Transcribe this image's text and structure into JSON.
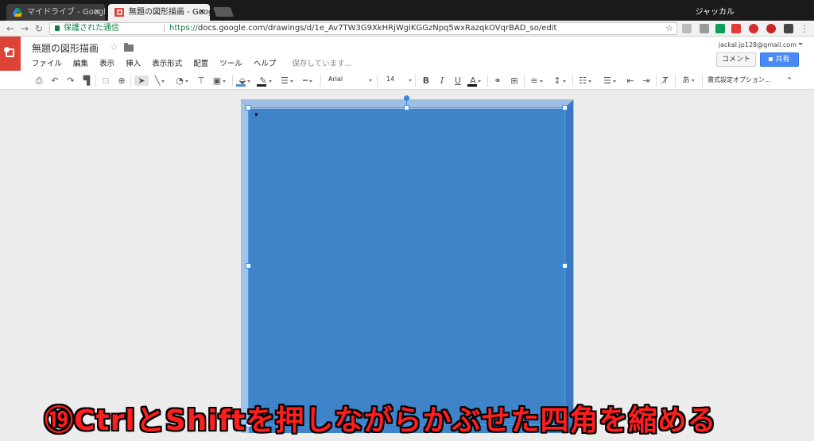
{
  "browser": {
    "tabs": [
      {
        "title": "マイドライブ - Google ドライ",
        "close": "✕",
        "active": false
      },
      {
        "title": "無題の図形描画 - Google",
        "close": "✕",
        "active": true
      }
    ],
    "profile_name": "ジャッカル",
    "address": {
      "secure_label": "保護された通信",
      "scheme": "https://",
      "url": "docs.google.com/drawings/d/1e_Av7TW3G9XkHRjWgiKGGzNpq5wxRazqkOVqrBAD_so/edit"
    }
  },
  "doc": {
    "title": "無題の図形描画",
    "menu": [
      "ファイル",
      "編集",
      "表示",
      "挿入",
      "表示形式",
      "配置",
      "ツール",
      "ヘルプ"
    ],
    "saving_status": "保存しています...",
    "account": "jackal.jp128@gmail.com",
    "comment_label": "コメント",
    "share_label": "共有"
  },
  "toolbar": {
    "font_name": "Arial",
    "font_size": "14",
    "bold": "B",
    "italic": "I",
    "underline": "U",
    "text_color": "A",
    "input_tools": "あ",
    "format_options": "書式設定オプション...",
    "fill_color": "#4a90d9",
    "line_color": "#222222"
  },
  "canvas": {
    "shape_color": "#3f84c8",
    "bevel_color": "#9dbfe6"
  },
  "caption": "⑲CtrlとShiftを押しながらかぶせた四角を縮める",
  "colors": {
    "caption": "#ff1e1e",
    "app_red": "#db4437",
    "share_blue": "#4a8af4"
  }
}
